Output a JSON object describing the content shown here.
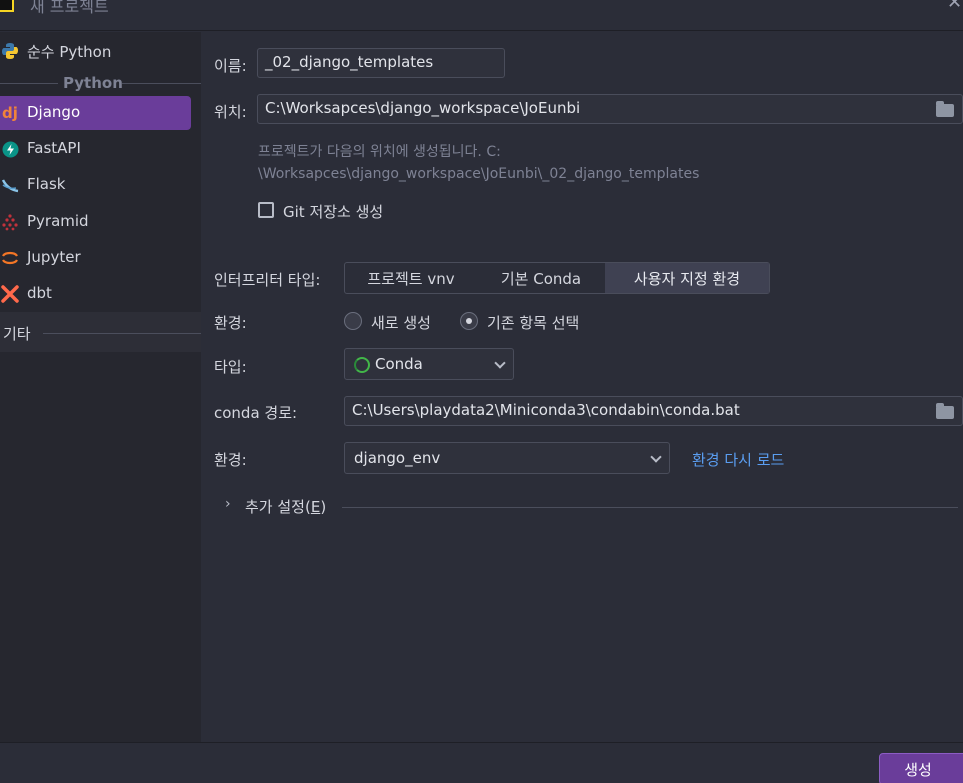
{
  "window": {
    "title": "새 프로젝트"
  },
  "sidebar": {
    "items": [
      {
        "label": "순수 Python",
        "icon": "python-icon",
        "color": "#3c78aa"
      },
      {
        "label": "Django",
        "icon": "django-icon",
        "color": "#f0833a"
      },
      {
        "label": "FastAPI",
        "icon": "fastapi-icon",
        "color": "#0a9488"
      },
      {
        "label": "Flask",
        "icon": "flask-icon",
        "color": "#8bc4e8"
      },
      {
        "label": "Pyramid",
        "icon": "pyramid-icon",
        "color": "#c0323c"
      },
      {
        "label": "Jupyter",
        "icon": "jupyter-icon",
        "color": "#f37626"
      },
      {
        "label": "dbt",
        "icon": "dbt-icon",
        "color": "#ff694b"
      }
    ],
    "group_python": "Python",
    "group_other": "기타",
    "selected": "Django"
  },
  "form": {
    "name_label": "이름:",
    "name_value": "_02_django_templates",
    "location_label": "위치:",
    "location_value": "C:\\Worksapces\\django_workspace\\JoEunbi",
    "hint_line1": "프로젝트가 다음의 위치에 생성됩니다. C:",
    "hint_line2": "\\Worksapces\\django_workspace\\JoEunbi\\_02_django_templates",
    "git_label": "Git 저장소 생성",
    "git_checked": false,
    "interpreter_label": "인터프리터 타입:",
    "interpreter_options": [
      "프로젝트 vnv",
      "기본 Conda",
      "사용자 지정 환경"
    ],
    "interpreter_selected": "사용자 지정 환경",
    "env_mode_label": "환경:",
    "env_mode_options": [
      "새로 생성",
      "기존 항목 선택"
    ],
    "env_mode_selected": "기존 항목 선택",
    "type_label": "타입:",
    "type_value": "Conda",
    "conda_path_label": "conda 경로:",
    "conda_path_value": "C:\\Users\\playdata2\\Miniconda3\\condabin\\conda.bat",
    "env_label": "환경:",
    "env_value": "django_env",
    "reload_link": "환경 다시 로드",
    "more_settings_prefix": "추가 설정(",
    "more_settings_mnemonic": "E",
    "more_settings_suffix": ")"
  },
  "footer": {
    "create_label": "생성"
  },
  "colors": {
    "accent": "#6a3d9a",
    "link": "#5a9df0",
    "background": "#2b2d38"
  }
}
